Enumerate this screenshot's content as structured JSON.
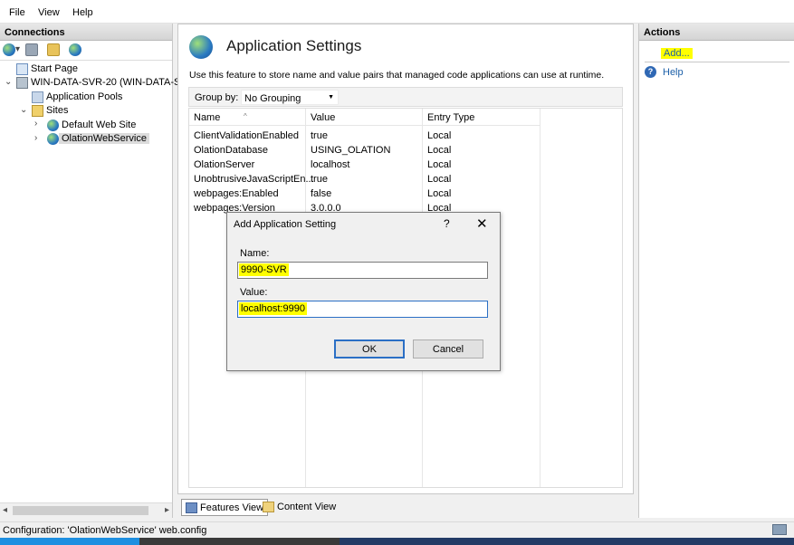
{
  "menu": {
    "items": [
      "File",
      "View",
      "Help"
    ]
  },
  "connections": {
    "header": "Connections",
    "tree": {
      "start_page": "Start Page",
      "server": "WIN-DATA-SVR-20 (WIN-DATA-SV",
      "app_pools": "Application Pools",
      "sites": "Sites",
      "default_site": "Default Web Site",
      "olation_site": "OlationWebService"
    }
  },
  "main": {
    "title": "Application Settings",
    "description": "Use this feature to store name and value pairs that managed code applications can use at runtime.",
    "group_by_label": "Group by:",
    "group_by_value": "No Grouping",
    "columns": [
      "Name",
      "Value",
      "Entry Type"
    ],
    "rows": [
      {
        "name": "ClientValidationEnabled",
        "value": "true",
        "type": "Local"
      },
      {
        "name": "OlationDatabase",
        "value": "USING_OLATION",
        "type": "Local"
      },
      {
        "name": "OlationServer",
        "value": "localhost",
        "type": "Local"
      },
      {
        "name": "UnobtrusiveJavaScriptEn...",
        "value": "true",
        "type": "Local"
      },
      {
        "name": "webpages:Enabled",
        "value": "false",
        "type": "Local"
      },
      {
        "name": "webpages:Version",
        "value": "3.0.0.0",
        "type": "Local"
      }
    ],
    "tabs": {
      "features_view": "Features View",
      "content_view": "Content View"
    }
  },
  "actions": {
    "header": "Actions",
    "add": "Add...",
    "help": "Help"
  },
  "dialog": {
    "title": "Add Application Setting",
    "help_glyph": "?",
    "close_glyph": "✕",
    "name_label": "Name:",
    "name_value": "9990-SVR",
    "value_label": "Value:",
    "value_value": "localhost:9990",
    "ok_label": "OK",
    "cancel_label": "Cancel"
  },
  "status": {
    "text": "Configuration: 'OlationWebService' web.config"
  },
  "colors": {
    "highlight": "#ffff00",
    "link": "#1b5fa8",
    "focus": "#2b6fc5"
  }
}
